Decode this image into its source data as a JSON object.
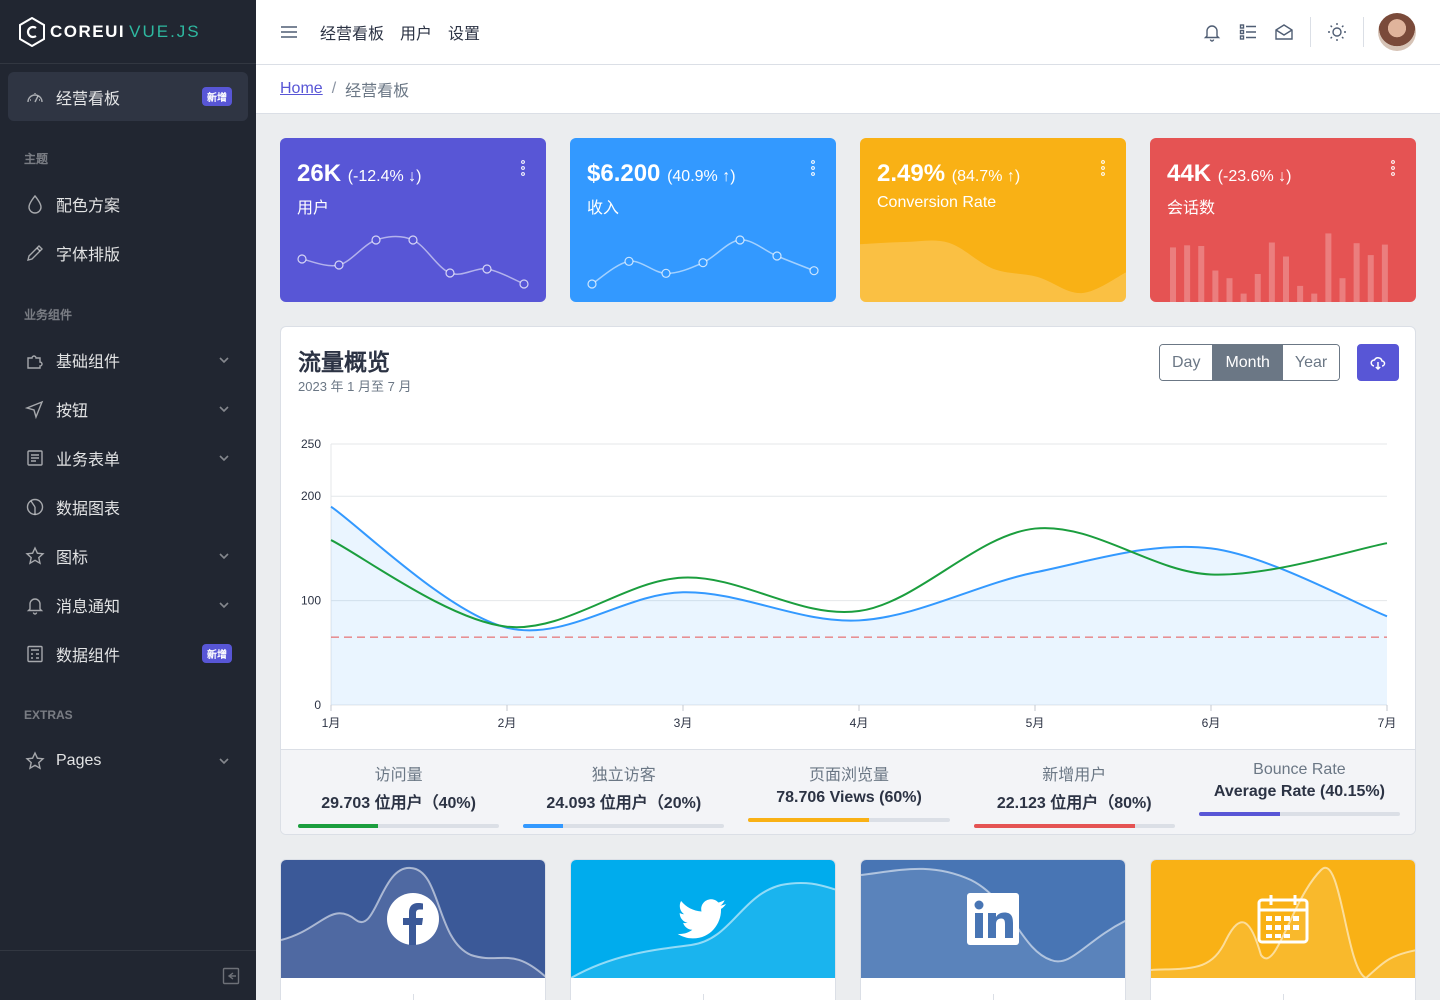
{
  "brand": {
    "name": "COREUI",
    "suffix": "VUE.JS"
  },
  "sidebar": {
    "items": [
      {
        "type": "item",
        "name": "sidebar-item-dashboard",
        "icon": "speedometer-icon",
        "label": "经营看板",
        "badge": "新增",
        "active": true
      },
      {
        "type": "title",
        "label": "主题"
      },
      {
        "type": "item",
        "name": "sidebar-item-colors",
        "icon": "drop-icon",
        "label": "配色方案"
      },
      {
        "type": "item",
        "name": "sidebar-item-typography",
        "icon": "pencil-icon",
        "label": "字体排版"
      },
      {
        "type": "title",
        "label": "业务组件"
      },
      {
        "type": "item",
        "name": "sidebar-item-base",
        "icon": "puzzle-icon",
        "label": "基础组件",
        "chevron": true
      },
      {
        "type": "item",
        "name": "sidebar-item-buttons",
        "icon": "cursor-icon",
        "label": "按钮",
        "chevron": true
      },
      {
        "type": "item",
        "name": "sidebar-item-forms",
        "icon": "notes-icon",
        "label": "业务表单",
        "chevron": true
      },
      {
        "type": "item",
        "name": "sidebar-item-charts",
        "icon": "chart-pie-icon",
        "label": "数据图表"
      },
      {
        "type": "item",
        "name": "sidebar-item-icons",
        "icon": "star-icon",
        "label": "图标",
        "chevron": true
      },
      {
        "type": "item",
        "name": "sidebar-item-notifications",
        "icon": "bell-icon",
        "label": "消息通知",
        "chevron": true
      },
      {
        "type": "item",
        "name": "sidebar-item-widgets",
        "icon": "calculator-icon",
        "label": "数据组件",
        "badge": "新增"
      },
      {
        "type": "title",
        "label": "EXTRAS"
      },
      {
        "type": "item",
        "name": "sidebar-item-pages",
        "icon": "star-icon",
        "label": "Pages",
        "chevron": true
      }
    ]
  },
  "header": {
    "nav": [
      "经营看板",
      "用户",
      "设置"
    ],
    "icons": [
      "bell-icon",
      "list-icon",
      "envelope-icon",
      "sun-icon"
    ]
  },
  "breadcrumb": {
    "home": "Home",
    "separator": "/",
    "current": "经营看板"
  },
  "widgets": [
    {
      "name": "widget-users",
      "value": "26K",
      "change": "(-12.4% ↓)",
      "label": "用户",
      "color": "#5856d6",
      "chart": "line",
      "data": [
        65,
        59,
        84,
        84,
        51,
        55,
        40
      ]
    },
    {
      "name": "widget-income",
      "value": "$6.200",
      "change": "(40.9% ↑)",
      "label": "收入",
      "color": "#3399ff",
      "chart": "line",
      "data": [
        1,
        18,
        9,
        17,
        34,
        22,
        11
      ]
    },
    {
      "name": "widget-conversion",
      "value": "2.49%",
      "change": "(84.7% ↑)",
      "label": "Conversion Rate",
      "color": "#f9b115",
      "chart": "area",
      "data": [
        78,
        81,
        80,
        45,
        34,
        12,
        40
      ]
    },
    {
      "name": "widget-sessions",
      "value": "44K",
      "change": "(-23.6% ↓)",
      "label": "会话数",
      "color": "#e55353",
      "chart": "bar",
      "data": [
        78,
        81,
        80,
        45,
        34,
        12,
        40,
        85,
        65,
        23,
        12,
        98,
        34,
        84,
        67,
        82
      ]
    }
  ],
  "traffic": {
    "title": "流量概览",
    "subtitle": "2023 年 1 月至 7 月",
    "periods": [
      "Day",
      "Month",
      "Year"
    ],
    "selected_period": "Month",
    "download_icon": "cloud-download-icon"
  },
  "chart_data": {
    "type": "line",
    "categories": [
      "1月",
      "2月",
      "3月",
      "4月",
      "5月",
      "6月",
      "7月"
    ],
    "ylim": [
      0,
      250
    ],
    "yticks": [
      0,
      100,
      200,
      250
    ],
    "series": [
      {
        "color": "#3399ff",
        "fill": true,
        "values": [
          190,
          74,
          108,
          81,
          127,
          150,
          85
        ]
      },
      {
        "color": "#1b9e3e",
        "fill": false,
        "values": [
          158,
          75,
          122,
          90,
          169,
          125,
          155
        ]
      },
      {
        "color": "#e55353",
        "dashed": true,
        "values": [
          65,
          65,
          65,
          65,
          65,
          65,
          65
        ]
      }
    ],
    "grid": true
  },
  "metrics": [
    {
      "name": "metric-visits",
      "label": "访问量",
      "value": "29.703 位用户（40%)",
      "percent": 40,
      "color": "#1b9e3e"
    },
    {
      "name": "metric-unique",
      "label": "独立访客",
      "value": "24.093 位用户（20%)",
      "percent": 20,
      "color": "#3399ff"
    },
    {
      "name": "metric-pageviews",
      "label": "页面浏览量",
      "value": "78.706 Views (60%)",
      "percent": 60,
      "color": "#f9b115"
    },
    {
      "name": "metric-newusers",
      "label": "新增用户",
      "value": "22.123 位用户（80%)",
      "percent": 80,
      "color": "#e55353"
    },
    {
      "name": "metric-bounce",
      "label": "Bounce Rate",
      "value": "Average Rate (40.15%)",
      "percent": 40.15,
      "color": "#5856d6"
    }
  ],
  "social": [
    {
      "name": "social-facebook",
      "icon": "facebook-icon",
      "color": "#3b5998"
    },
    {
      "name": "social-twitter",
      "icon": "twitter-icon",
      "color": "#00aced"
    },
    {
      "name": "social-linkedin",
      "icon": "linkedin-icon",
      "color": "#4875b4"
    },
    {
      "name": "social-calendar",
      "icon": "calendar-icon",
      "color": "#f9b115"
    }
  ]
}
